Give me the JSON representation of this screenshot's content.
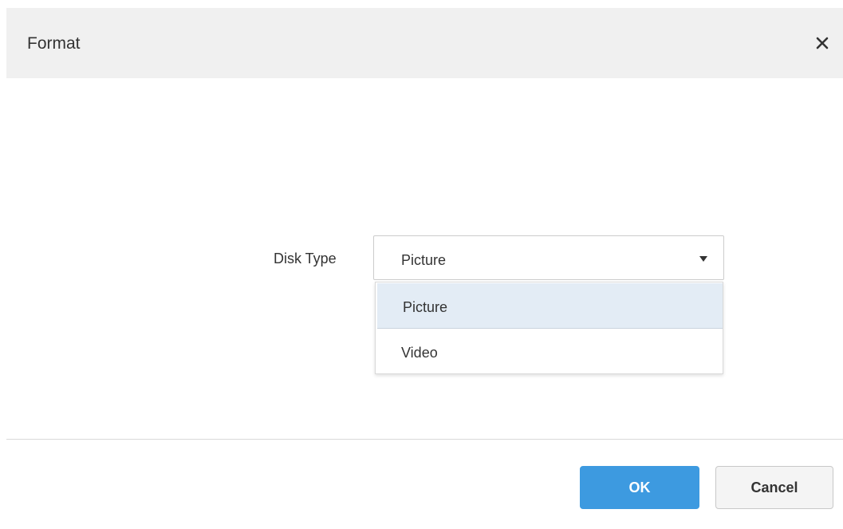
{
  "dialog": {
    "title": "Format",
    "close_icon": "close-icon"
  },
  "form": {
    "disk_type_label": "Disk Type",
    "disk_type_value": "Picture",
    "arrow_icon": "caret-down-icon",
    "options": [
      {
        "label": "Picture",
        "selected": true
      },
      {
        "label": "Video",
        "selected": false
      }
    ]
  },
  "footer": {
    "ok_label": "OK",
    "cancel_label": "Cancel"
  },
  "colors": {
    "primary": "#3d9ae0",
    "header_bg": "#f0f0f0",
    "selected_option_bg": "#e3ecf5"
  }
}
